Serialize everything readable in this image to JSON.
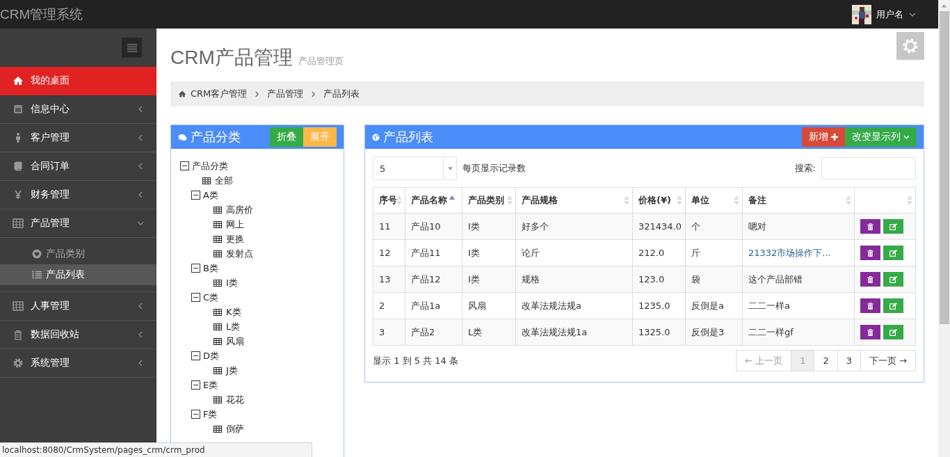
{
  "app": {
    "title": "CRM管理系统"
  },
  "user": {
    "name": "用户名"
  },
  "sidebar": {
    "items": [
      {
        "label": "我的桌面",
        "kind": "link",
        "selected": true
      },
      {
        "label": "信息中心",
        "kind": "menu",
        "selected": false,
        "expanded": false
      },
      {
        "label": "客户管理",
        "kind": "menu",
        "selected": false,
        "expanded": false
      },
      {
        "label": "合同订单",
        "kind": "menu",
        "selected": false,
        "expanded": false
      },
      {
        "label": "财务管理",
        "kind": "menu",
        "selected": false,
        "expanded": false
      },
      {
        "label": "产品管理",
        "kind": "menu",
        "selected": false,
        "expanded": true,
        "children": [
          {
            "label": "产品类别",
            "selected": false
          },
          {
            "label": "产品列表",
            "selected": true
          }
        ]
      },
      {
        "label": "人事管理",
        "kind": "menu",
        "selected": false,
        "expanded": false
      },
      {
        "label": "数据回收站",
        "kind": "menu",
        "selected": false,
        "expanded": false
      },
      {
        "label": "系统管理",
        "kind": "menu",
        "selected": false,
        "expanded": false
      }
    ]
  },
  "page": {
    "title": "CRM产品管理",
    "subtitle": "产品管理页"
  },
  "breadcrumb": [
    "CRM客户管理",
    "产品管理",
    "产品列表"
  ],
  "category_panel": {
    "title": "产品分类",
    "buttons": [
      {
        "label": "折叠",
        "kind": "success"
      },
      {
        "label": "展开",
        "kind": "warning"
      }
    ],
    "tree": [
      {
        "label": "产品分类",
        "expanded": true,
        "children": [
          {
            "label": "全部"
          },
          {
            "label": "A类",
            "expanded": true,
            "children": [
              {
                "label": "高房价"
              },
              {
                "label": "网上"
              },
              {
                "label": "更换"
              },
              {
                "label": "发射点"
              }
            ]
          },
          {
            "label": "B类",
            "expanded": true,
            "children": [
              {
                "label": "I类"
              }
            ]
          },
          {
            "label": "C类",
            "expanded": true,
            "children": [
              {
                "label": "K类"
              },
              {
                "label": "L类"
              },
              {
                "label": "风扇"
              }
            ]
          },
          {
            "label": "D类",
            "expanded": true,
            "children": [
              {
                "label": "J类"
              }
            ]
          },
          {
            "label": "E类",
            "expanded": true,
            "children": [
              {
                "label": "花花"
              }
            ]
          },
          {
            "label": "F类",
            "expanded": true,
            "children": [
              {
                "label": "倒萨"
              }
            ]
          }
        ]
      }
    ]
  },
  "product_panel": {
    "title": "产品列表",
    "buttons": [
      {
        "label": "新增",
        "kind": "danger"
      },
      {
        "label": "改变显示列",
        "kind": "success"
      }
    ],
    "page_size": "5",
    "page_size_label": "每页显示记录数",
    "search_label": "搜索:",
    "table": {
      "columns": [
        {
          "label": "序号",
          "sorted": false
        },
        {
          "label": "产品名称",
          "sorted": true
        },
        {
          "label": "产品类别",
          "sorted": false
        },
        {
          "label": "产品规格",
          "sorted": false
        },
        {
          "label": "价格(¥)",
          "sorted": false
        },
        {
          "label": "单位",
          "sorted": false
        },
        {
          "label": "备注",
          "sorted": false
        },
        {
          "sorted": false
        }
      ],
      "rows": [
        {
          "cells": [
            "11",
            "产品10",
            "I类",
            "好多个",
            "321434.0",
            "个",
            "嗯对"
          ],
          "note_link": false
        },
        {
          "cells": [
            "12",
            "产品11",
            "I类",
            "论斤",
            "212.0",
            "斤",
            "21332市场操作下..."
          ],
          "note_link": true
        },
        {
          "cells": [
            "13",
            "产品12",
            "I类",
            "规格",
            "123.0",
            "袋",
            "这个产品部错"
          ],
          "note_link": false
        },
        {
          "cells": [
            "2",
            "产品1a",
            "风扇",
            "改革法规法规a",
            "1235.0",
            "反倒是a",
            "二二一样a"
          ],
          "note_link": false
        },
        {
          "cells": [
            "3",
            "产品2",
            "L类",
            "改革法规法规1a",
            "1325.0",
            "反倒是3",
            "二二一样gf"
          ],
          "note_link": false
        }
      ]
    },
    "summary": "显示 1 到 5 共 14 条",
    "pagination": [
      {
        "label": "← 上一页",
        "selected": false,
        "disabled": true
      },
      {
        "label": "1",
        "selected": true,
        "disabled": false
      },
      {
        "label": "2",
        "selected": false,
        "disabled": false
      },
      {
        "label": "3",
        "selected": false,
        "disabled": false
      },
      {
        "label": "下一页 →",
        "selected": false,
        "disabled": false
      }
    ]
  },
  "status_bar": {
    "url": "localhost:8080/CrmSystem/pages_crm/crm_prod"
  }
}
